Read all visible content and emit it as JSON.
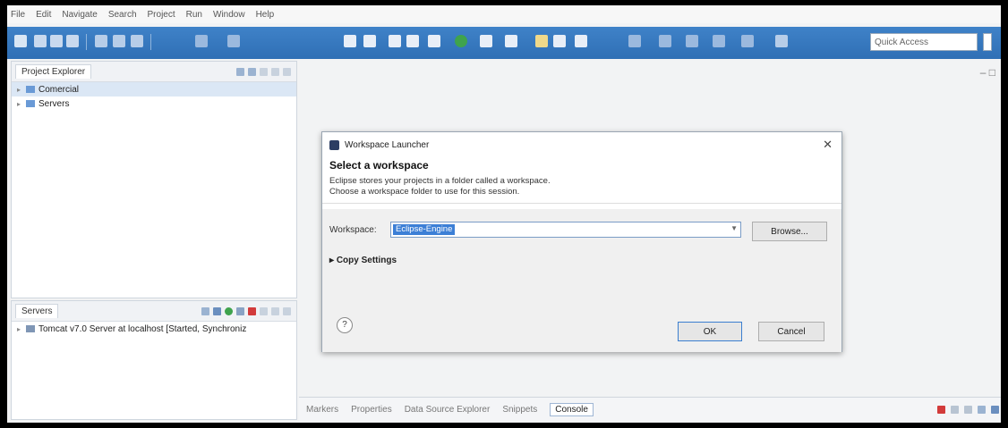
{
  "menu": [
    "File",
    "Edit",
    "Navigate",
    "Search",
    "Project",
    "Run",
    "Window",
    "Help"
  ],
  "quick_access": "Quick Access",
  "project_explorer": {
    "title": "Project Explorer",
    "items": [
      "Comercial",
      "Servers"
    ]
  },
  "servers_view": {
    "title": "Servers",
    "items": [
      "Tomcat v7.0 Server at localhost  [Started, Synchroniz"
    ]
  },
  "dialog": {
    "title": "Workspace Launcher",
    "heading": "Select a workspace",
    "desc1": "Eclipse stores your projects in a folder called a workspace.",
    "desc2": "Choose a workspace folder to use for this session.",
    "workspace_label": "Workspace:",
    "workspace_value": "Eclipse-Engine",
    "browse": "Browse...",
    "copy_settings": "Copy Settings",
    "help": "?",
    "ok": "OK",
    "cancel": "Cancel"
  },
  "bottom_tabs": [
    "Markers",
    "Properties",
    "Data Source Explorer",
    "Snippets",
    "Console"
  ]
}
